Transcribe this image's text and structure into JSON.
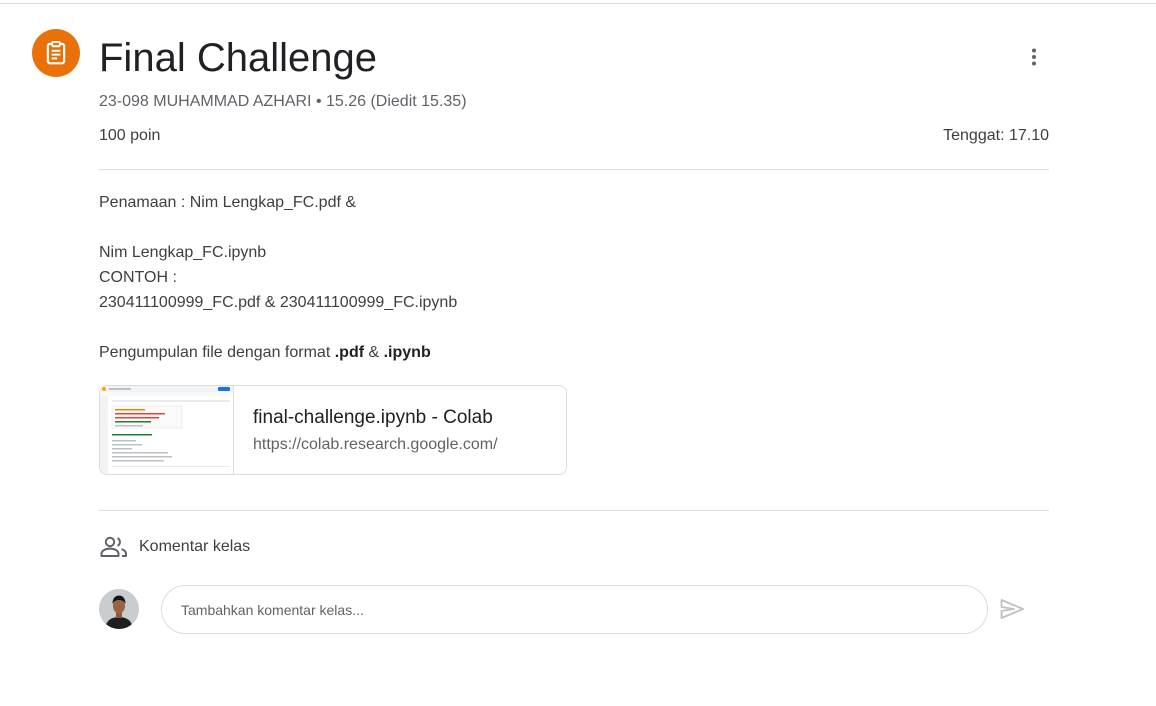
{
  "assignment": {
    "icon": "assignment-icon",
    "title": "Final Challenge",
    "meta": "23-098 MUHAMMAD AZHARI • 15.26 (Diedit 15.35)",
    "points": "100 poin",
    "due": "Tenggat: 17.10"
  },
  "description": {
    "line1": "Penamaan : Nim Lengkap_FC.pdf &",
    "line2": "Nim Lengkap_FC.ipynb",
    "line3": "CONTOH :",
    "line4": "230411100999_FC.pdf & 230411100999_FC.ipynb",
    "line5_prefix": "Pengumpulan file dengan format ",
    "line5_bold1": ".pdf",
    "line5_mid": " & ",
    "line5_bold2": ".ipynb"
  },
  "attachment": {
    "title": "final-challenge.ipynb - Colab",
    "url": "https://colab.research.google.com/"
  },
  "comments": {
    "icon": "people-icon",
    "label": "Komentar kelas",
    "placeholder": "Tambahkan komentar kelas...",
    "send_icon": "send-icon"
  },
  "colors": {
    "accent": "#e8710a",
    "divider": "#dadce0",
    "text": "#3c4043",
    "muted": "#5f6368"
  }
}
